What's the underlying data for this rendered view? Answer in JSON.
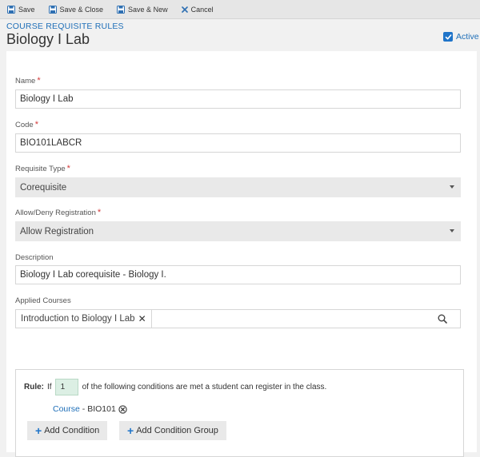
{
  "toolbar": {
    "save": "Save",
    "save_close": "Save & Close",
    "save_new": "Save & New",
    "cancel": "Cancel"
  },
  "header": {
    "breadcrumb": "COURSE REQUISITE RULES",
    "title": "Biology I Lab",
    "active_label": "Active",
    "active_checked": true
  },
  "form": {
    "name": {
      "label": "Name",
      "required_mark": "*",
      "value": "Biology I Lab"
    },
    "code": {
      "label": "Code",
      "required_mark": "*",
      "value": "BIO101LABCR"
    },
    "requisite_type": {
      "label": "Requisite Type",
      "required_mark": "*",
      "value": "Corequisite"
    },
    "allow_deny": {
      "label": "Allow/Deny Registration",
      "required_mark": "*",
      "value": "Allow Registration"
    },
    "description": {
      "label": "Description",
      "value": "Biology I Lab corequisite - Biology I."
    },
    "applied_courses": {
      "label": "Applied Courses",
      "tags": [
        "Introduction to Biology I Lab"
      ],
      "remove_glyph": "✕"
    }
  },
  "rule": {
    "label": "Rule:",
    "if_text": "If",
    "count": "1",
    "suffix": "of the following conditions are met a student can register in the class.",
    "condition": {
      "link": "Course",
      "separator": " - ",
      "value": "BIO101"
    },
    "add_condition": "Add Condition",
    "add_condition_group": "Add Condition Group",
    "plus_glyph": "+"
  },
  "colors": {
    "accent": "#1f74c9",
    "link": "#1f6fb8",
    "required": "#d43a3a",
    "rule_input_bg": "#dcefe4"
  },
  "icons": [
    "save-icon",
    "save-close-icon",
    "save-new-icon",
    "cancel-icon",
    "checkbox-check-icon",
    "chevron-down-icon",
    "close-icon",
    "search-icon",
    "circle-x-icon",
    "plus-icon"
  ]
}
